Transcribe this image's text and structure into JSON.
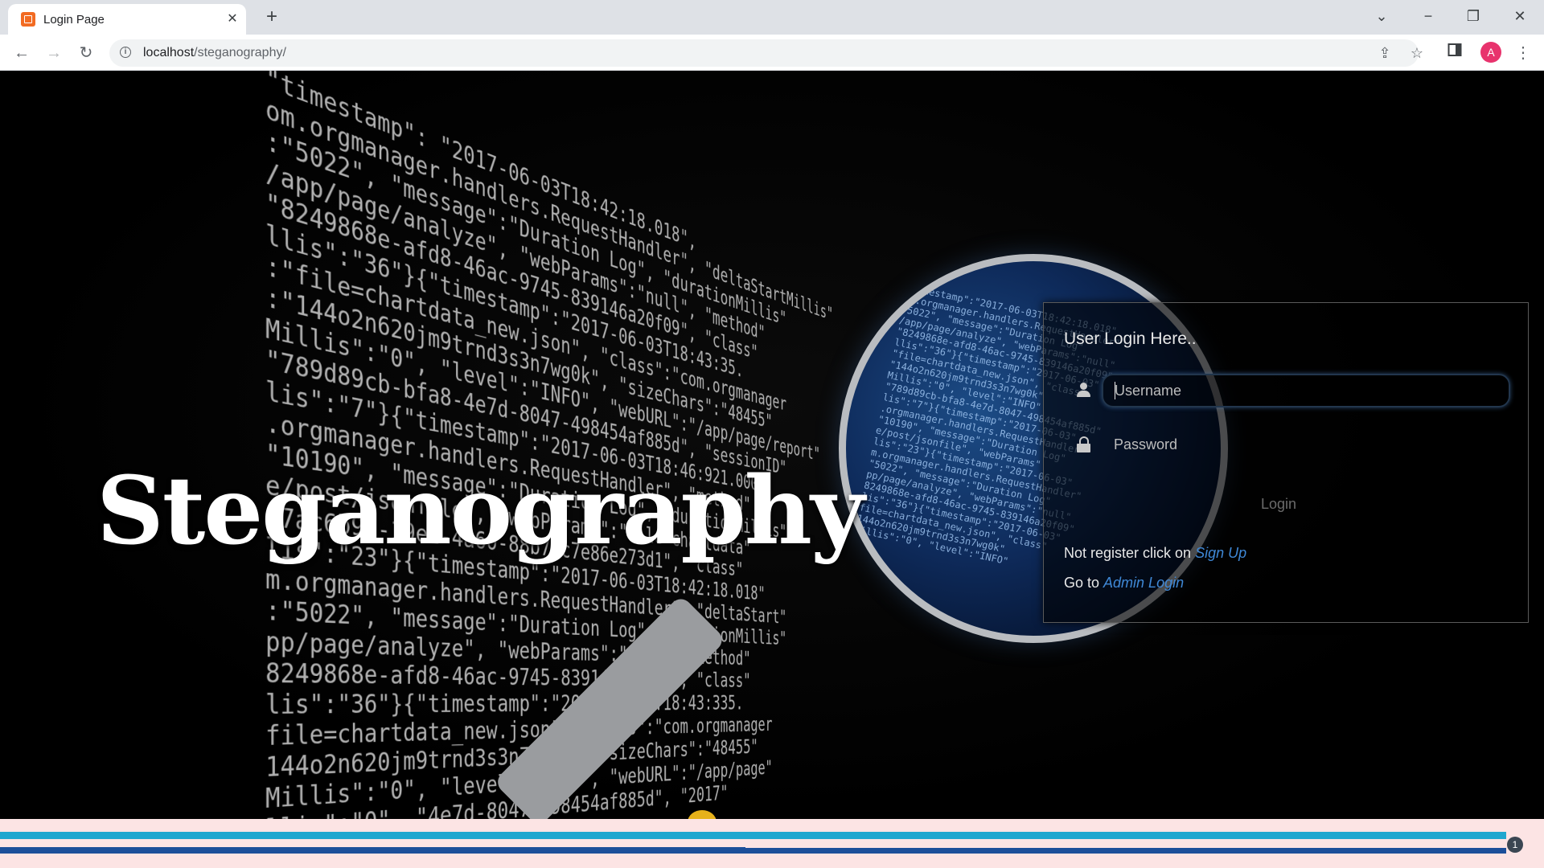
{
  "browser": {
    "tab_title": "Login Page",
    "new_tab_symbol": "+",
    "url_host": "localhost",
    "url_path": "/steganography/",
    "profile_initial": "A"
  },
  "hero": {
    "title": "Steganography"
  },
  "code_lines": [
    "  \"timestamp\": \"2017-06-03T18:42:18.018\",",
    "om.orgmanager.handlers.RequestHandler\", \"deltaStartMillis\"",
    ":\"5022\", \"message\":\"Duration Log\", \"durationMillis\"",
    "/app/page/analyze\", \"webParams\":\"null\", \"method\"",
    "\"8249868e-afd8-46ac-9745-839146a20f09\", \"class\"",
    "llis\":\"36\"}{\"timestamp\":\"2017-06-03T18:43:35.",
    ":\"file=chartdata_new.json\", \"class\":\"com.orgmanager",
    ":\"144o2n620jm9trnd3s3n7wg0k\", \"sizeChars\":\"48455\"",
    "Millis\":\"0\", \"level\":\"INFO\", \"webURL\":\"/app/page/report\"",
    "\"789d89cb-bfa8-4e7d-8047-498454af885d\", \"sessionID\"",
    "lis\":\"7\"}{\"timestamp\":\"2017-06-03T18:46:921.000",
    ".orgmanager.handlers.RequestHandler\", \"method\"",
    "\"10190\", \"message\":\"Duration Log\", \"durationMillis\"",
    "e/post/jsonfile\", \"webParams\":\"file=chartdata\"",
    "\"7ac6b95-19e2-4a60-88b7-c7e86e273d1\", \"class\"",
    "lis\":\"23\"}{\"timestamp\":\"2017-06-03T18:42:18.018\"",
    "m.orgmanager.handlers.RequestHandler\", \"deltaStart\"",
    ":\"5022\", \"message\":\"Duration Log\", \"durationMillis\"",
    "pp/page/analyze\", \"webParams\":\"null\", \"method\"",
    "8249868e-afd8-46ac-9745-839146a20f09\", \"class\"",
    "lis\":\"36\"}{\"timestamp\":\"2017-06-03T18:43:335.",
    "file=chartdata_new.json\", \"class\":\"com.orgmanager",
    "144o2n620jm9trnd3s3n7wg0k\", \"sizeChars\":\"48455\"",
    "Millis\":\"0\", \"level\":\"INFO\", \"webURL\":\"/app/page\"",
    "llis\":\"0\", \"4e7d-8047-498454af885d\", \"2017\""
  ],
  "lens_lines": [
    "\"timestamp\":\"2017-06-03T18:42:18.018\"",
    "om.orgmanager.handlers.RequestHandler\"",
    "\"5022\", \"message\":\"Duration Log\"",
    "/app/page/analyze\", \"webParams\":\"null\"",
    "\"8249868e-afd8-46ac-9745-839146a20f09\"",
    "llis\":\"36\"}{\"timestamp\":\"2017-06-03\"",
    "\"file=chartdata_new.json\", \"class\"",
    "\"144o2n620jm9trnd3s3n7wg0k\"",
    "Millis\":\"0\", \"level\":\"INFO\"",
    "\"789d89cb-bfa8-4e7d-8047-498454af885d\"",
    "lis\":\"7\"}{\"timestamp\":\"2017-06-03\"",
    ".orgmanager.handlers.RequestHandler\"",
    "\"10190\", \"message\":\"Duration Log\"",
    "e/post/jsonfile\", \"webParams\"",
    "lis\":\"23\"}{\"timestamp\":\"2017-06-03\"",
    "m.orgmanager.handlers.RequestHandler\"",
    "\"5022\", \"message\":\"Duration Log\"",
    "pp/page/analyze\", \"webParams\":\"null\"",
    "8249868e-afd8-46ac-9745-839146a20f09\"",
    "lis\":\"36\"}{\"timestamp\":\"2017-06-03\"",
    "file=chartdata_new.json\", \"class\"",
    "144o2n620jm9trnd3s3n7wg0k\"",
    "Millis\":\"0\", \"level\":\"INFO\""
  ],
  "login": {
    "heading": "User Login Here..",
    "username_placeholder": "Username",
    "password_placeholder": "Password",
    "login_button": "Login",
    "signup_prefix": "Not register click on ",
    "signup_link": "Sign Up",
    "admin_prefix": "Go to ",
    "admin_link": "Admin Login"
  },
  "bottom_bar": {
    "badge": "1"
  },
  "colors": {
    "link": "#3f88d6",
    "bar_cyan": "#1fa7cf",
    "bar_blue": "#1c4f9a",
    "avatar": "#e8336d"
  },
  "icons": [
    "tab-favicon",
    "close-icon",
    "back-icon",
    "forward-icon",
    "reload-icon",
    "info-icon",
    "share-icon",
    "star-icon",
    "side-panel-icon",
    "menu-icon",
    "user-icon",
    "lock-icon"
  ]
}
